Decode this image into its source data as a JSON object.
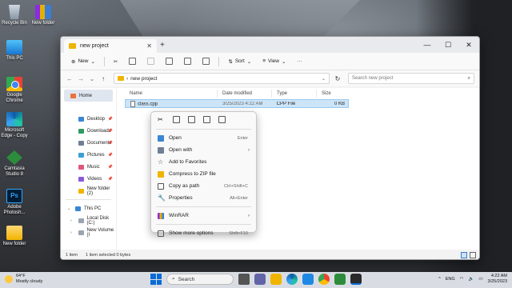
{
  "colors": {
    "accent": "#0a6cd6",
    "selection": "#cce4f7",
    "folder": "#f0b400"
  },
  "desktop": {
    "icons": [
      {
        "label": "Recycle Bin",
        "icon": "recycle-bin-icon"
      },
      {
        "label": "New folder",
        "icon": "winrar-folder-icon"
      },
      {
        "label": "This PC",
        "icon": "this-pc-icon"
      },
      {
        "label": "Google Chrome",
        "icon": "chrome-icon"
      },
      {
        "label": "Microsoft Edge - Copy",
        "icon": "edge-icon"
      },
      {
        "label": "Camtasia Studio 8",
        "icon": "camtasia-icon"
      },
      {
        "label": "Adobe Photosh...",
        "icon": "photoshop-icon"
      },
      {
        "label": "New folder",
        "icon": "folder-icon"
      }
    ]
  },
  "window": {
    "tab_title": "new project",
    "toolbar": {
      "new_label": "New",
      "sort_label": "Sort",
      "view_label": "View",
      "more_label": "···"
    },
    "address": {
      "path": "new project",
      "search_placeholder": "Search new project"
    },
    "nav_pane": {
      "home": "Home",
      "quick_access": [
        {
          "label": "Desktop",
          "icon": "desktop-icon"
        },
        {
          "label": "Downloads",
          "icon": "downloads-icon"
        },
        {
          "label": "Documents",
          "icon": "documents-icon"
        },
        {
          "label": "Pictures",
          "icon": "pictures-icon"
        },
        {
          "label": "Music",
          "icon": "music-icon"
        },
        {
          "label": "Videos",
          "icon": "videos-icon"
        },
        {
          "label": "New folder (2)",
          "icon": "folder-icon"
        }
      ],
      "this_pc": "This PC",
      "drives": [
        {
          "label": "Local Disk (C:)"
        },
        {
          "label": "New Volume (I"
        }
      ]
    },
    "columns": [
      "Name",
      "Date modified",
      "Type",
      "Size"
    ],
    "files": [
      {
        "name": "class.cpp",
        "date": "3/25/2023 4:22 AM",
        "type": "CPP File",
        "size": "0 KB"
      }
    ],
    "status": {
      "items": "1 item",
      "selected": "1 item selected  0 bytes"
    }
  },
  "context_menu": {
    "items": [
      {
        "label": "Open",
        "shortcut": "Enter",
        "icon": "open-icon"
      },
      {
        "label": "Open with",
        "shortcut": "›",
        "icon": "open-with-icon"
      },
      {
        "label": "Add to Favorites",
        "shortcut": "",
        "icon": "star-icon"
      },
      {
        "label": "Compress to ZIP file",
        "shortcut": "",
        "icon": "zip-icon"
      },
      {
        "label": "Copy as path",
        "shortcut": "Ctrl+Shift+C",
        "icon": "copy-path-icon"
      },
      {
        "label": "Properties",
        "shortcut": "Alt+Enter",
        "icon": "properties-icon"
      }
    ],
    "winrar": {
      "label": "WinRAR",
      "shortcut": "›"
    },
    "more": {
      "label": "Show more options",
      "shortcut": "Shift+F10"
    }
  },
  "taskbar": {
    "weather_temp": "64°F",
    "weather_desc": "Mostly cloudy",
    "search_label": "Search",
    "language": "ENG",
    "time": "4:22 AM",
    "date": "3/25/2023"
  }
}
